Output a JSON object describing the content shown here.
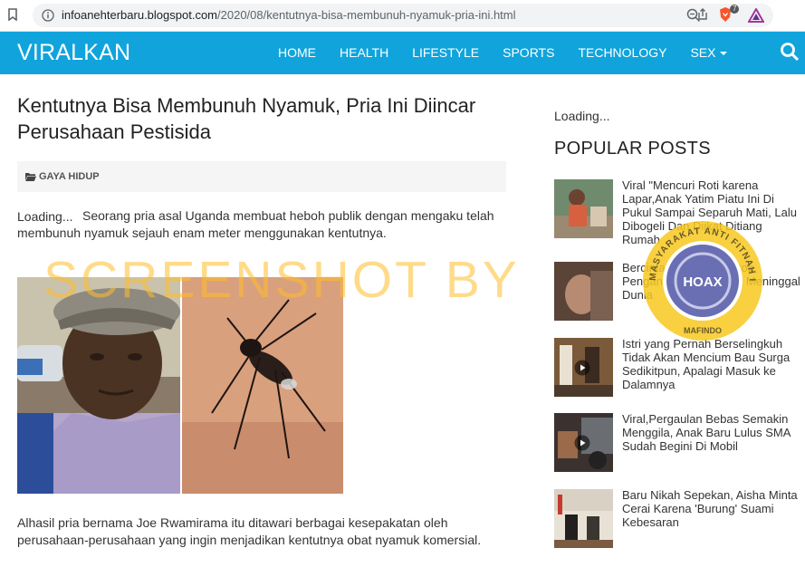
{
  "browser": {
    "url_host": "infoanehterbaru.blogspot.com",
    "url_path": "/2020/08/kentutnya-bisa-membunuh-nyamuk-pria-ini.html",
    "brave_badge": "7"
  },
  "site": {
    "brand": "VIRALKAN",
    "nav": [
      "HOME",
      "HEALTH",
      "LIFESTYLE",
      "SPORTS",
      "TECHNOLOGY",
      "SEX"
    ]
  },
  "article": {
    "title": "Kentutnya Bisa Membunuh Nyamuk, Pria Ini Diincar Perusahaan Pestisida",
    "category": "GAYA HIDUP",
    "loading": "Loading...",
    "lead": "Seorang pria asal Uganda membuat heboh publik dengan mengaku telah membunuh nyamuk sejauh enam meter menggunakan kentutnya.",
    "para2": "Alhasil pria bernama Joe Rwamirama itu ditawari berbagai kesepakatan oleh perusahaan-perusahaan yang ingin menjadikan kentutnya obat nyamuk komersial."
  },
  "sidebar": {
    "loading": "Loading...",
    "popular_title": "POPULAR POSTS",
    "posts": [
      {
        "title": "Viral \"Mencuri Roti karena Lapar,Anak Yatim Piatu Ini Di Pukul Sampai Separuh Mati, Lalu Dibogeli Dan Diikat Ditiang Rumah"
      },
      {
        "title": "Bercinta 48 Jam Nonstop, Pengantin Baru Wanita Meninggal Dunia"
      },
      {
        "title": "Istri yang Pernah Berselingkuh Tidak Akan Mencium Bau Surga Sedikitpun, Apalagi Masuk ke Dalamnya"
      },
      {
        "title": "Viral,Pergaulan Bebas Semakin Menggila, Anak Baru Lulus SMA Sudah Begini Di Mobil"
      },
      {
        "title": "Baru Nikah Sepekan, Aisha Minta Cerai Karena 'Burung' Suami Kebesaran"
      }
    ]
  },
  "overlay": {
    "watermark": "SCREENSHOT BY",
    "seal_text_outer": "MASYARAKAT ANTI FITNAH INDONESIA",
    "seal_text_inner": "HOAX",
    "seal_text_bottom": "MAFINDO"
  },
  "colors": {
    "navbar": "#11a4dc",
    "watermark": "#ffbe28",
    "seal": "#f7c81e"
  }
}
